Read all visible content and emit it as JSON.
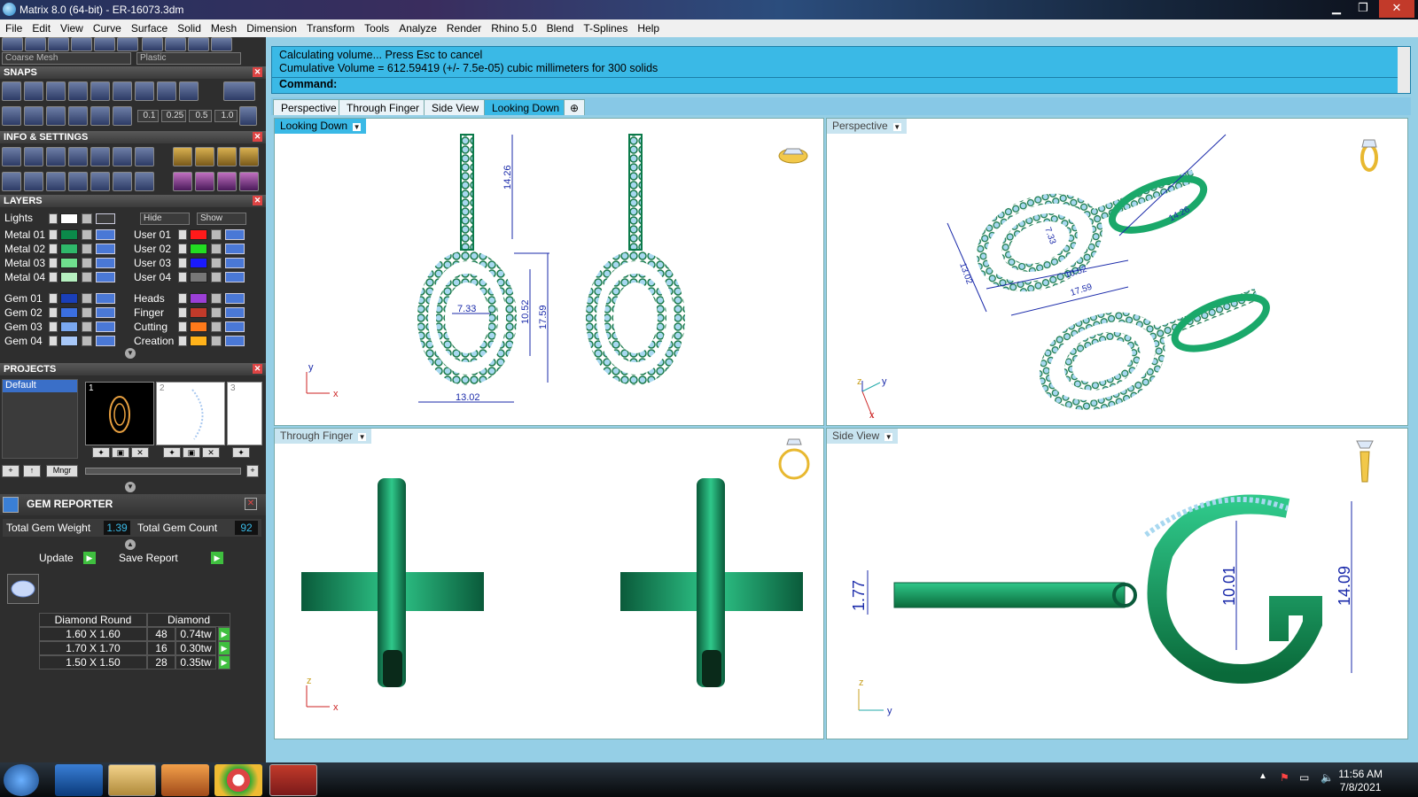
{
  "window": {
    "title": "Matrix 8.0 (64-bit) - ER-16073.3dm",
    "min": "▁",
    "max": "❐",
    "close": "✕"
  },
  "menu": [
    "File",
    "Edit",
    "View",
    "Curve",
    "Surface",
    "Solid",
    "Mesh",
    "Dimension",
    "Transform",
    "Tools",
    "Analyze",
    "Render",
    "Rhino 5.0",
    "Blend",
    "T-Splines",
    "Help"
  ],
  "toolbar": {
    "mesh_combo": "Coarse Mesh",
    "material_combo": "Plastic"
  },
  "panels": {
    "snaps": "SNAPS",
    "snap_values": [
      "0.1",
      "0.25",
      "0.5",
      "1.0"
    ],
    "info": "INFO & SETTINGS",
    "layers": "LAYERS",
    "projects": "PROJECTS",
    "gem_reporter": "GEM REPORTER"
  },
  "layers": {
    "lights": "Lights",
    "hide": "Hide",
    "show": "Show",
    "left": [
      {
        "name": "Metal 01",
        "color": "#0b8a4a"
      },
      {
        "name": "Metal 02",
        "color": "#2fb86a"
      },
      {
        "name": "Metal 03",
        "color": "#6fe08e"
      },
      {
        "name": "Metal 04",
        "color": "#b6f0c0"
      },
      {
        "name": "Gem 01",
        "color": "#1a3fb8"
      },
      {
        "name": "Gem 02",
        "color": "#3b6fe0"
      },
      {
        "name": "Gem 03",
        "color": "#7aa8f0"
      },
      {
        "name": "Gem 04",
        "color": "#a8c8f8"
      }
    ],
    "right": [
      {
        "name": "User 01",
        "color": "#ff1a1a"
      },
      {
        "name": "User 02",
        "color": "#22dd22"
      },
      {
        "name": "User 03",
        "color": "#1a1aff"
      },
      {
        "name": "User 04",
        "color": "#777777"
      },
      {
        "name": "Heads",
        "color": "#9b3fd6"
      },
      {
        "name": "Finger",
        "color": "#c23a2a"
      },
      {
        "name": "Cutting",
        "color": "#ff7a1a"
      },
      {
        "name": "Creation",
        "color": "#ffb21a"
      }
    ]
  },
  "projects": {
    "default": "Default",
    "thumbs": [
      "1",
      "2",
      "3"
    ],
    "mngr": "Mngr"
  },
  "gem": {
    "weight_label": "Total Gem Weight",
    "weight": "1.39",
    "count_label": "Total Gem Count",
    "count": "92",
    "update": "Update",
    "save_report": "Save Report",
    "header": [
      "Diamond Round",
      "Diamond"
    ],
    "rows": [
      {
        "size": "1.60 X 1.60",
        "qty": "48",
        "tw": "0.74tw"
      },
      {
        "size": "1.70 X 1.70",
        "qty": "16",
        "tw": "0.30tw"
      },
      {
        "size": "1.50 X 1.50",
        "qty": "28",
        "tw": "0.35tw"
      }
    ]
  },
  "command": {
    "line1": "Calculating volume... Press Esc to cancel",
    "line2": "Cumulative Volume = 612.59419 (+/- 7.5e-05) cubic millimeters for 300 solids",
    "prompt": "Command:"
  },
  "tabs": [
    "Perspective",
    "Through Finger",
    "Side View",
    "Looking Down"
  ],
  "active_tab": "Looking Down",
  "tab_add": "⊕",
  "viewports": {
    "top_left": {
      "label": "Looking Down",
      "dims": [
        "14.26",
        "7.33",
        "10.52",
        "17.59",
        "13.02"
      ],
      "axes": [
        "y",
        "x"
      ]
    },
    "top_right": {
      "label": "Perspective",
      "dims": [
        "13.02",
        "10.52",
        "17.59",
        "7.33",
        "14.26"
      ],
      "axes": [
        "z",
        "y",
        "x"
      ]
    },
    "bottom_left": {
      "label": "Through Finger",
      "axes": [
        "z",
        "x"
      ]
    },
    "bottom_right": {
      "label": "Side View",
      "dims": [
        "1.77",
        "10.01",
        "14.09"
      ],
      "axes": [
        "z",
        "y"
      ]
    }
  },
  "taskbar": {
    "time": "11:56 AM",
    "date": "7/8/2021"
  }
}
